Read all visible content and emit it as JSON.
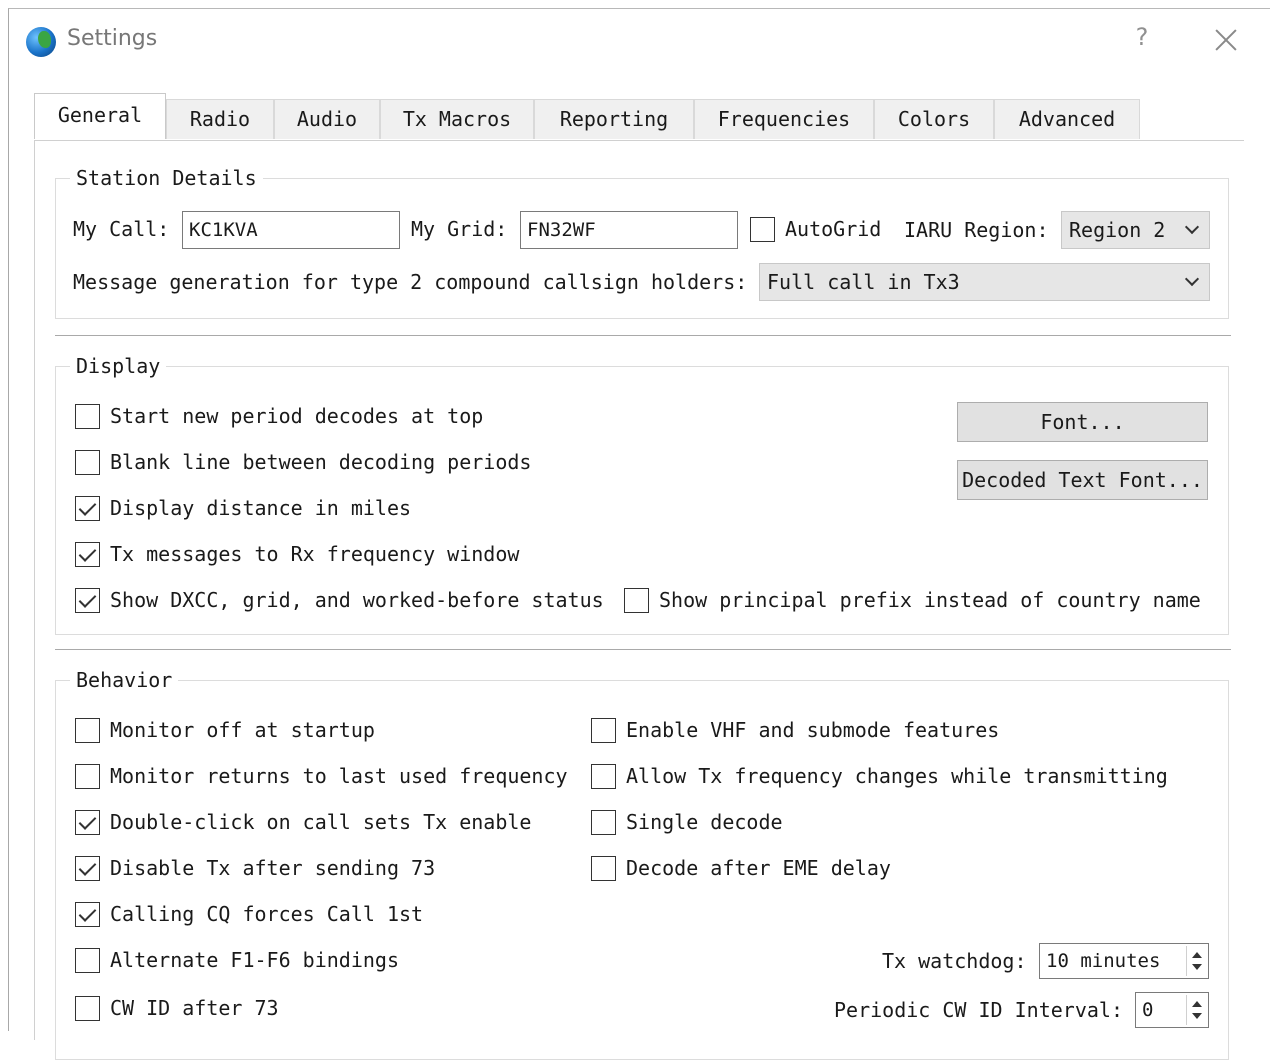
{
  "window": {
    "title": "Settings",
    "help": "?"
  },
  "tabs": [
    "General",
    "Radio",
    "Audio",
    "Tx Macros",
    "Reporting",
    "Frequencies",
    "Colors",
    "Advanced"
  ],
  "station": {
    "title": "Station Details",
    "my_call_label": "My Call:",
    "my_call_value": "KC1KVA",
    "my_grid_label": "My Grid:",
    "my_grid_value": "FN32WF",
    "autogrid_label": "AutoGrid",
    "autogrid_checked": false,
    "iaru_label": "IARU Region:",
    "iaru_value": "Region 2",
    "msg_gen_label": "Message generation for type 2 compound callsign holders:",
    "msg_gen_value": "Full call in Tx3"
  },
  "display": {
    "title": "Display",
    "items": [
      {
        "label": "Start new period decodes at top",
        "checked": false
      },
      {
        "label": "Blank line between decoding periods",
        "checked": false
      },
      {
        "label": "Display distance in miles",
        "checked": true
      },
      {
        "label": "Tx messages to Rx frequency window",
        "checked": true
      },
      {
        "label": "Show DXCC, grid, and worked-before status",
        "checked": true
      },
      {
        "label": "Show principal prefix instead of country name",
        "checked": false
      }
    ],
    "font_button": "Font...",
    "decoded_font_button": "Decoded Text Font..."
  },
  "behavior": {
    "title": "Behavior",
    "left": [
      {
        "label": "Monitor off at startup",
        "checked": false
      },
      {
        "label": "Monitor returns to last used frequency",
        "checked": false
      },
      {
        "label": "Double-click on call sets Tx enable",
        "checked": true
      },
      {
        "label": "Disable Tx after sending 73",
        "checked": true
      },
      {
        "label": "Calling CQ forces Call 1st",
        "checked": true
      },
      {
        "label": "Alternate F1-F6 bindings",
        "checked": false
      },
      {
        "label": "CW ID after 73",
        "checked": false
      }
    ],
    "right": [
      {
        "label": "Enable VHF and submode features",
        "checked": false
      },
      {
        "label": "Allow Tx frequency changes while transmitting",
        "checked": false
      },
      {
        "label": "Single decode",
        "checked": false
      },
      {
        "label": "Decode after EME delay",
        "checked": false
      }
    ],
    "watchdog_label": "Tx watchdog:",
    "watchdog_value": "10 minutes",
    "cw_interval_label": "Periodic CW ID Interval:",
    "cw_interval_value": "0"
  }
}
